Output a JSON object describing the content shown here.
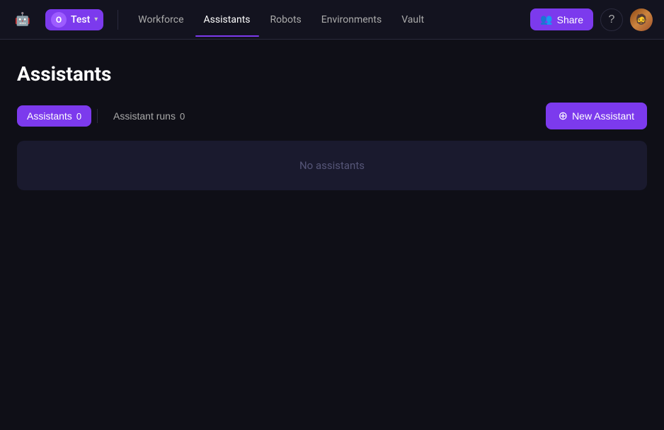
{
  "app": {
    "logo": "🤖"
  },
  "workspace": {
    "letter": "O",
    "name": "Test",
    "chevron": "▾"
  },
  "nav": {
    "links": [
      {
        "id": "workforce",
        "label": "Workforce",
        "active": false
      },
      {
        "id": "assistants",
        "label": "Assistants",
        "active": true
      },
      {
        "id": "robots",
        "label": "Robots",
        "active": false
      },
      {
        "id": "environments",
        "label": "Environments",
        "active": false
      },
      {
        "id": "vault",
        "label": "Vault",
        "active": false
      }
    ],
    "share_label": "Share",
    "help_icon": "?"
  },
  "page": {
    "title": "Assistants"
  },
  "tabs": [
    {
      "id": "assistants-tab",
      "label": "Assistants",
      "count": "0",
      "active": true
    },
    {
      "id": "assistant-runs-tab",
      "label": "Assistant runs",
      "count": "0",
      "active": false
    }
  ],
  "new_assistant_button": "New Assistant",
  "empty_state": {
    "message": "No assistants"
  }
}
